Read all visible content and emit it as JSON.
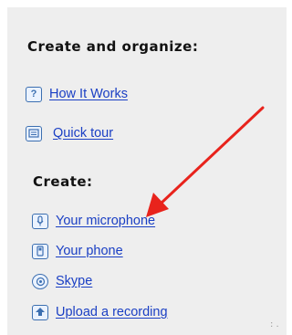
{
  "panel": {
    "title": "Create and organize:",
    "top_links": [
      {
        "label": "How It Works",
        "icon": "question-icon"
      },
      {
        "label": "Quick tour",
        "icon": "slideshow-icon"
      }
    ],
    "create_heading": "Create:",
    "create_links": [
      {
        "label": "Your microphone",
        "icon": "microphone-icon"
      },
      {
        "label": "Your phone",
        "icon": "phone-icon"
      },
      {
        "label": "Skype",
        "icon": "skype-icon"
      },
      {
        "label": "Upload a recording",
        "icon": "upload-icon"
      }
    ]
  },
  "annotation": {
    "arrow_color": "#e8231c",
    "arrow_target": "Your microphone"
  },
  "colors": {
    "link": "#1a3fc4",
    "icon_border": "#3c6fb0",
    "panel_bg": "#eeeeee"
  }
}
